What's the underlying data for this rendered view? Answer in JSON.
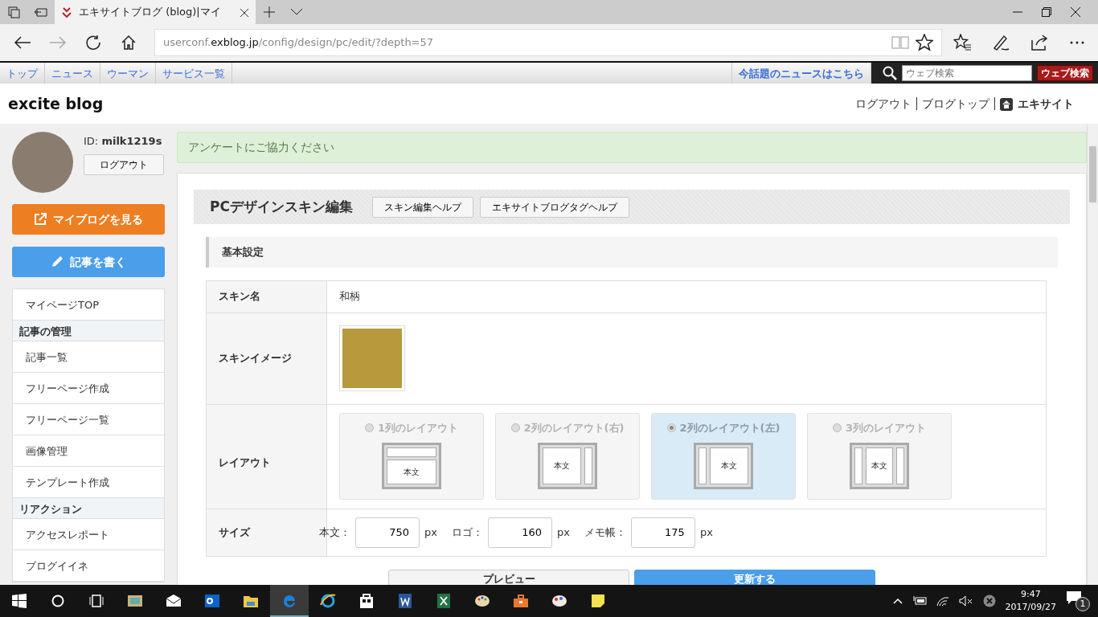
{
  "browser": {
    "tabs": [
      {
        "title": "エキサイトブログ (blog)|マイ",
        "selected": true
      }
    ],
    "address": {
      "subdomain": "userconf.",
      "domain": "exblog.jp",
      "path": "/config/design/pc/edit/?depth=57"
    }
  },
  "site_nav": {
    "links": [
      "トップ",
      "ニュース",
      "ウーマン",
      "サービス一覧"
    ],
    "news_link": "今話題のニュースはこちら",
    "search": {
      "placeholder": "ウェブ検索",
      "button": "ウェブ検索"
    }
  },
  "header": {
    "logo": "excite blog",
    "links": [
      "ログアウト",
      "ブログトップ",
      "エキサイト"
    ]
  },
  "sidebar": {
    "id_label": "ID:",
    "user_id": "milk1219s",
    "logout": "ログアウト",
    "buttons": [
      {
        "label": "マイブログを見る",
        "kind": "view",
        "color": "#ee7e22"
      },
      {
        "label": "記事を書く",
        "kind": "write",
        "color": "#4a9eea"
      }
    ],
    "menu": [
      {
        "label": "マイページTOP",
        "kind": "link"
      },
      {
        "label": "記事の管理",
        "kind": "heading"
      },
      {
        "label": "記事一覧",
        "kind": "link"
      },
      {
        "label": "フリーページ作成",
        "kind": "link"
      },
      {
        "label": "フリーページ一覧",
        "kind": "link"
      },
      {
        "label": "画像管理",
        "kind": "link"
      },
      {
        "label": "テンプレート作成",
        "kind": "link"
      },
      {
        "label": "リアクション",
        "kind": "heading"
      },
      {
        "label": "アクセスレポート",
        "kind": "link"
      },
      {
        "label": "ブログイイネ",
        "kind": "link"
      }
    ]
  },
  "alert": "アンケートにご協力ください",
  "editor": {
    "title": "PCデザインスキン編集",
    "help_buttons": [
      "スキン編集ヘルプ",
      "エキサイトブログタグヘルプ"
    ],
    "section": "基本設定",
    "skin_name": {
      "label": "スキン名",
      "value": "和柄"
    },
    "skin_image": {
      "label": "スキンイメージ"
    },
    "layout": {
      "label": "レイアウト",
      "options": [
        {
          "label": "1列のレイアウト",
          "kind": "one",
          "selected": false,
          "disabled": true,
          "body": "本文"
        },
        {
          "label": "2列のレイアウト(右)",
          "kind": "right",
          "selected": false,
          "disabled": true,
          "body": "本文"
        },
        {
          "label": "2列のレイアウト(左)",
          "kind": "left",
          "selected": true,
          "disabled": true,
          "body": "本文"
        },
        {
          "label": "3列のレイアウト",
          "kind": "three",
          "selected": false,
          "disabled": true,
          "body": "本文"
        }
      ]
    },
    "size": {
      "label": "サイズ",
      "fields": [
        {
          "label": "本文：",
          "value": "750",
          "unit": "px"
        },
        {
          "label": "ロゴ：",
          "value": "160",
          "unit": "px"
        },
        {
          "label": "メモ帳：",
          "value": "175",
          "unit": "px"
        }
      ]
    },
    "actions": [
      {
        "label": "プレビュー",
        "kind": "secondary"
      },
      {
        "label": "更新する",
        "kind": "primary"
      }
    ]
  },
  "taskbar": {
    "apps": [
      {
        "kind": "photos",
        "selected": false
      },
      {
        "kind": "mail",
        "selected": false
      },
      {
        "kind": "outlook",
        "selected": false
      },
      {
        "kind": "folder",
        "selected": false
      },
      {
        "kind": "edge",
        "selected": true
      },
      {
        "kind": "ie",
        "selected": false
      },
      {
        "kind": "store",
        "selected": false
      },
      {
        "kind": "word",
        "selected": false
      },
      {
        "kind": "excel",
        "selected": false
      },
      {
        "kind": "paint",
        "selected": false
      },
      {
        "kind": "toolbox",
        "selected": false
      },
      {
        "kind": "palette",
        "selected": false
      },
      {
        "kind": "note",
        "selected": false
      }
    ],
    "time": "9:47",
    "date": "2017/09/27",
    "notifications": "1"
  }
}
